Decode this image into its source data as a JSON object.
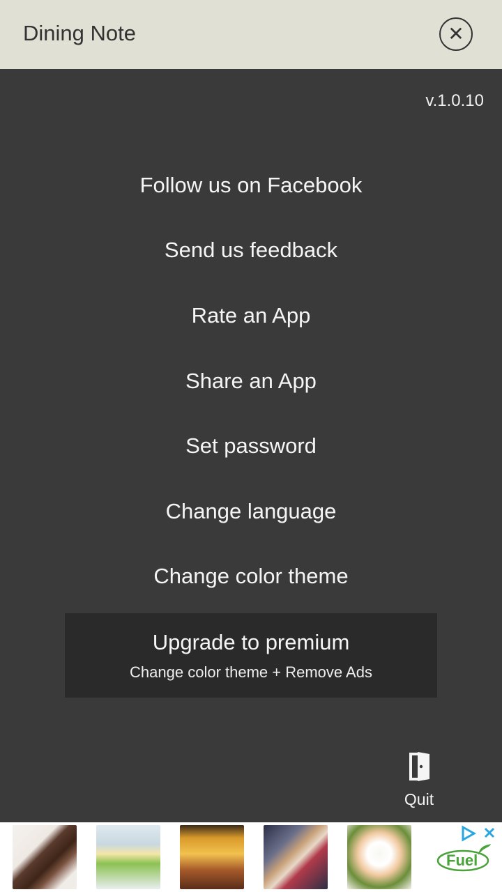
{
  "header": {
    "title": "Dining Note"
  },
  "version": "v.1.0.10",
  "menu": {
    "items": [
      {
        "label": "Follow us on Facebook"
      },
      {
        "label": "Send us feedback"
      },
      {
        "label": "Rate an App"
      },
      {
        "label": "Share an App"
      },
      {
        "label": "Set password"
      },
      {
        "label": "Change language"
      },
      {
        "label": "Change color theme"
      }
    ]
  },
  "premium": {
    "title": "Upgrade to premium",
    "subtitle": "Change color theme + Remove Ads"
  },
  "quit": {
    "label": "Quit",
    "icon": "door-exit-icon"
  },
  "ad": {
    "brand": "Fuel",
    "thumbnails": [
      "brownie-image",
      "low-fat-tub-image",
      "shepherds-pie-image",
      "dessert-plate-image",
      "poached-egg-image"
    ],
    "colors": {
      "brand_green": "#4aa23a",
      "adchoices_blue": "#2aa7e0"
    }
  },
  "colors": {
    "header_bg": "#e1e0d5",
    "body_bg": "#3a3a3a",
    "premium_bg": "#2a2a2a",
    "text_light": "#f5f5f5"
  }
}
